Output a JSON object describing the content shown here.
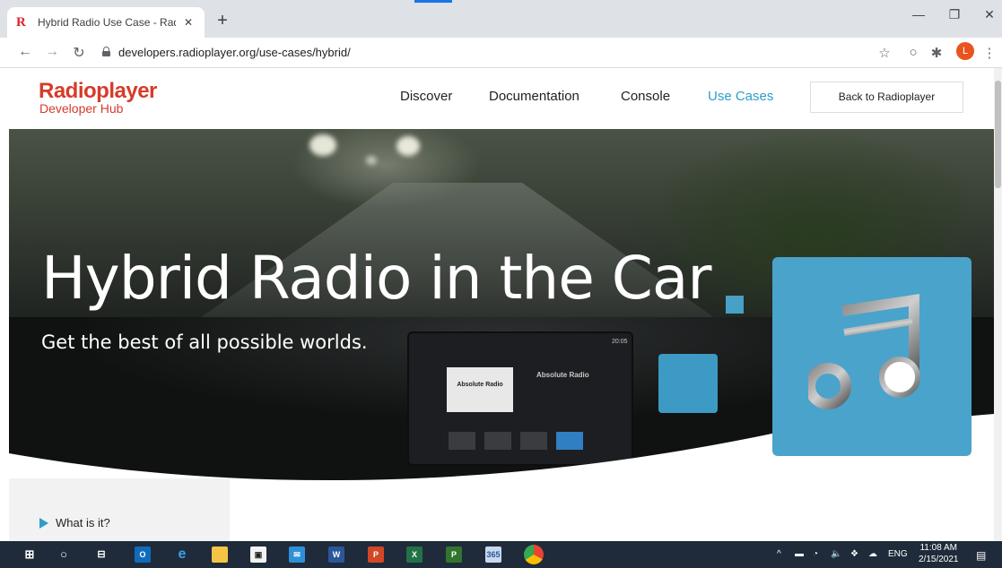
{
  "browser": {
    "tab_title": "Hybrid Radio Use Case - Radiopl",
    "url": "developers.radioplayer.org/use-cases/hybrid/",
    "profile_initial": "L"
  },
  "site": {
    "logo": "Radioplayer",
    "logo_sub": "Developer Hub",
    "nav": [
      "Discover",
      "Documentation",
      "Console",
      "Use Cases"
    ],
    "active_nav": "Use Cases",
    "back_button": "Back to Radioplayer"
  },
  "hero": {
    "title": "Hybrid Radio in the Car",
    "subtitle": "Get the best of all possible worlds.",
    "screen": {
      "time": "20:05",
      "station": "Absolute Radio",
      "tile_label": "Absolute Radio"
    }
  },
  "content": {
    "accordion_item": "What is it?"
  },
  "taskbar": {
    "time": "11:08 AM",
    "date": "2/15/2021",
    "language": "ENG"
  },
  "colors": {
    "brand_red": "#d63b2a",
    "accent_blue": "#2e9ec9",
    "music_box": "#4aa3cb"
  }
}
